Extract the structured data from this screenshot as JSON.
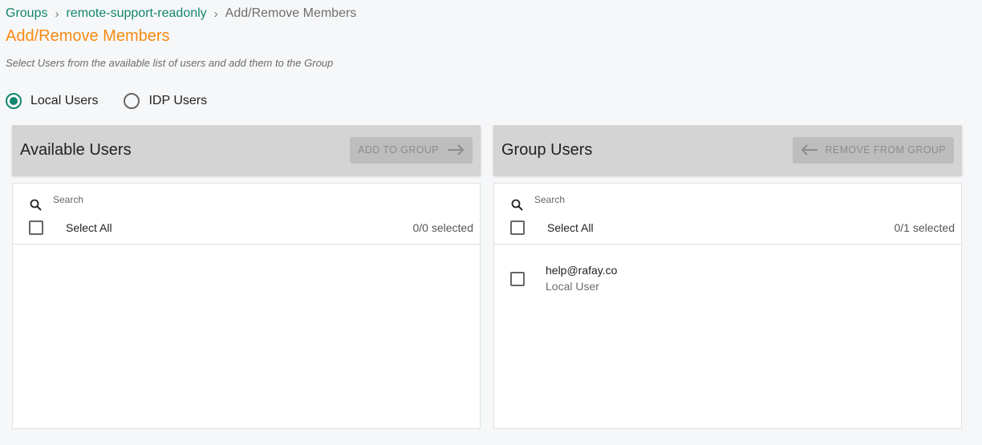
{
  "breadcrumb": {
    "items": [
      "Groups",
      "remote-support-readonly"
    ],
    "current": "Add/Remove Members",
    "separator": "›"
  },
  "page": {
    "title": "Add/Remove Members",
    "subtitle": "Select Users from the available list of users and add them to the Group"
  },
  "user_source": {
    "options": [
      "Local Users",
      "IDP Users"
    ],
    "selected": "Local Users"
  },
  "available_panel": {
    "title": "Available Users",
    "button_label": "ADD TO GROUP",
    "search_placeholder": "Search",
    "select_all_label": "Select All",
    "selected_count": "0/0 selected",
    "users": []
  },
  "group_panel": {
    "title": "Group Users",
    "button_label": "REMOVE FROM GROUP",
    "search_placeholder": "Search",
    "select_all_label": "Select All",
    "selected_count": "0/1 selected",
    "users": [
      {
        "email": "help@rafay.co",
        "type": "Local User"
      }
    ]
  },
  "colors": {
    "accent": "#12866f",
    "title": "#f78a12",
    "header_bg": "#d4d4d4",
    "button_bg": "#bdbdbd"
  },
  "icons": [
    "search-icon",
    "arrow-right-icon",
    "arrow-left-icon"
  ]
}
